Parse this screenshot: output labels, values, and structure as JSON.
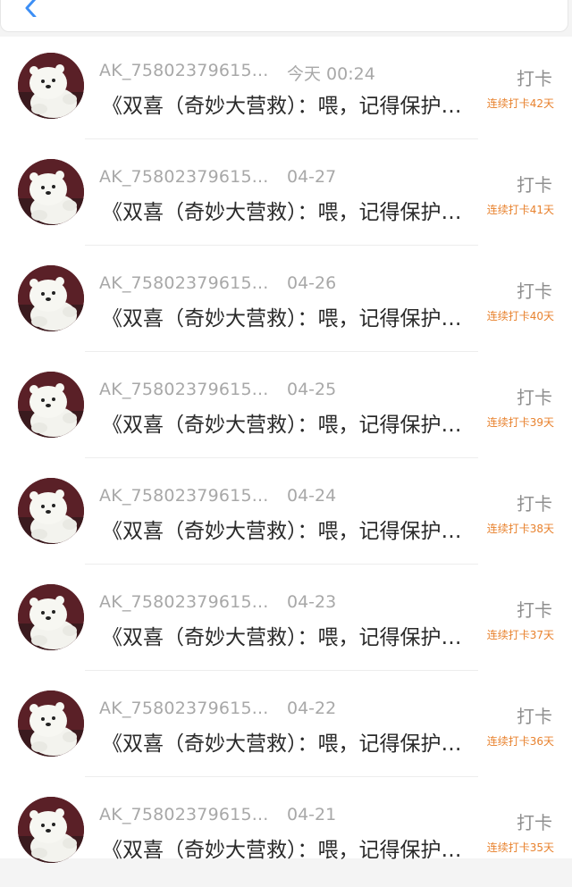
{
  "header": {
    "back_icon": "chevron-left-icon",
    "accent": "#3d8ff5"
  },
  "items": [
    {
      "name": "AK_75802379615...",
      "date": "今天 00:24",
      "message": "《双喜（奇妙大营救）：喂，记得保护…",
      "action": "打卡",
      "streak": "连续打卡42天"
    },
    {
      "name": "AK_75802379615...",
      "date": "04-27",
      "message": "《双喜（奇妙大营救）：喂，记得保护…",
      "action": "打卡",
      "streak": "连续打卡41天"
    },
    {
      "name": "AK_75802379615...",
      "date": "04-26",
      "message": "《双喜（奇妙大营救）：喂，记得保护…",
      "action": "打卡",
      "streak": "连续打卡40天"
    },
    {
      "name": "AK_75802379615...",
      "date": "04-25",
      "message": "《双喜（奇妙大营救）：喂，记得保护…",
      "action": "打卡",
      "streak": "连续打卡39天"
    },
    {
      "name": "AK_75802379615...",
      "date": "04-24",
      "message": "《双喜（奇妙大营救）：喂，记得保护…",
      "action": "打卡",
      "streak": "连续打卡38天"
    },
    {
      "name": "AK_75802379615...",
      "date": "04-23",
      "message": "《双喜（奇妙大营救）：喂，记得保护…",
      "action": "打卡",
      "streak": "连续打卡37天"
    },
    {
      "name": "AK_75802379615...",
      "date": "04-22",
      "message": "《双喜（奇妙大营救）：喂，记得保护…",
      "action": "打卡",
      "streak": "连续打卡36天"
    },
    {
      "name": "AK_75802379615...",
      "date": "04-21",
      "message": "《双喜（奇妙大营救）：喂，记得保护…",
      "action": "打卡",
      "streak": "连续打卡35天"
    }
  ],
  "colors": {
    "streak": "#e8822e",
    "name": "#a8a8a8",
    "message": "#2a2a2a"
  }
}
